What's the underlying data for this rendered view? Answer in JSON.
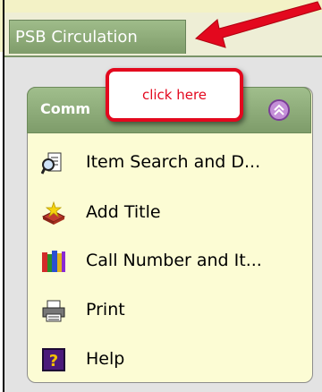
{
  "tab": {
    "label": "PSB Circulation"
  },
  "panel": {
    "title": "Comm"
  },
  "callout": {
    "text": "click here"
  },
  "items": [
    {
      "label": "Item Search and D...",
      "icon": "search-document-icon"
    },
    {
      "label": "Add Title",
      "icon": "add-book-icon"
    },
    {
      "label": "Call Number and It...",
      "icon": "book-stack-icon"
    },
    {
      "label": "Print",
      "icon": "printer-icon"
    },
    {
      "label": "Help",
      "icon": "help-icon"
    }
  ],
  "colors": {
    "tab_green": "#8fad7a",
    "panel_bg": "#fcfcd4",
    "callout_red": "#e3081e"
  }
}
